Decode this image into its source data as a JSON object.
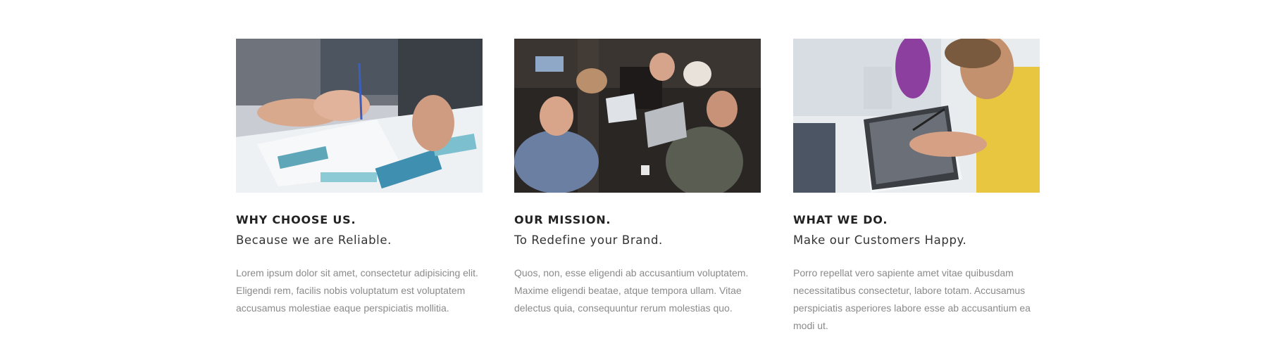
{
  "features": [
    {
      "title": "WHY CHOOSE US.",
      "subtitle": "Because we are Reliable.",
      "text": "Lorem ipsum dolor sit amet, consectetur adipisicing elit. Eligendi rem, facilis nobis voluptatum est voluptatem accusamus molestiae eaque perspiciatis mollitia.",
      "image": "hands-writing-on-papers-photo"
    },
    {
      "title": "OUR MISSION.",
      "subtitle": "To Redefine your Brand.",
      "text": "Quos, non, esse eligendi ab accusantium voluptatem. Maxime eligendi beatae, atque tempora ullam. Vitae delectus quia, consequuntur rerum molestias quo.",
      "image": "people-with-laptops-meeting-photo"
    },
    {
      "title": "WHAT WE DO.",
      "subtitle": "Make our Customers Happy.",
      "text": "Porro repellat vero sapiente amet vitae quibusdam necessitatibus consectetur, labore totam. Accusamus perspiciatis asperiores labore esse ab accusantium ea modi ut.",
      "image": "man-drawing-on-tablet-photo"
    }
  ]
}
